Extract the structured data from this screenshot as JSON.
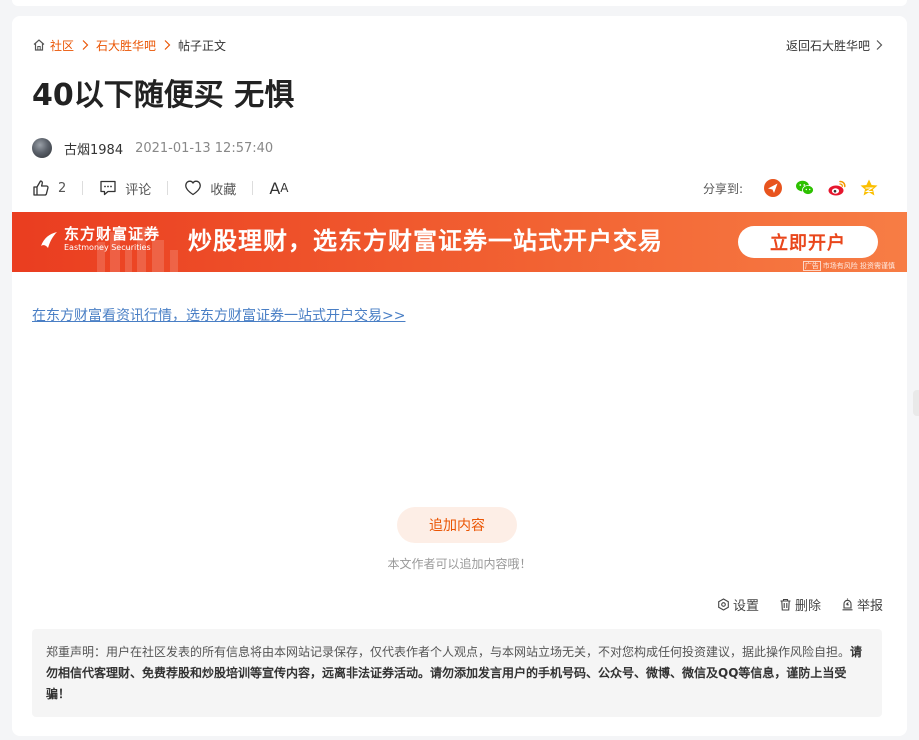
{
  "breadcrumb": {
    "home": "社区",
    "forum": "石大胜华吧",
    "current": "帖子正文"
  },
  "back_link": "返回石大胜华吧",
  "post": {
    "title": "40以下随便买 无惧",
    "author": "古烟1984",
    "time": "2021-01-13 12:57:40"
  },
  "actions": {
    "like_count": "2",
    "comment_label": "评论",
    "favorite_label": "收藏",
    "font_big": "A",
    "font_small": "A"
  },
  "share": {
    "label": "分享到:",
    "icons": [
      "weibo-toutiao-icon",
      "wechat-icon",
      "sina-weibo-icon",
      "qzone-icon"
    ]
  },
  "banner": {
    "logo_cn": "东方财富证券",
    "logo_en": "Eastmoney Securities",
    "slogan": "炒股理财，选东方财富证券一站式开户交易",
    "button": "立即开户",
    "ad_tag": "广告",
    "note": "市场有风险 投资需谨慎"
  },
  "promo_link": "在东方财富看资讯行情，选东方财富证券一站式开户交易>>",
  "add_content": {
    "button": "追加内容",
    "hint": "本文作者可以追加内容哦！"
  },
  "tools": {
    "settings": "设置",
    "delete": "删除",
    "report": "举报"
  },
  "disclaimer": {
    "part1": "郑重声明：用户在社区发表的所有信息将由本网站记录保存，仅代表作者个人观点，与本网站立场无关，不对您构成任何投资建议，据此操作风险自担。",
    "part2": "请勿相信代客理财、免费荐股和炒股培训等宣传内容，远离非法证券活动。请勿添加发言用户的手机号码、公众号、微博、微信及QQ等信息，谨防上当受骗！"
  },
  "colors": {
    "accent": "#ea5504",
    "link": "#4a7fc5",
    "banner_start": "#ea3d20",
    "banner_end": "#f77d45"
  }
}
